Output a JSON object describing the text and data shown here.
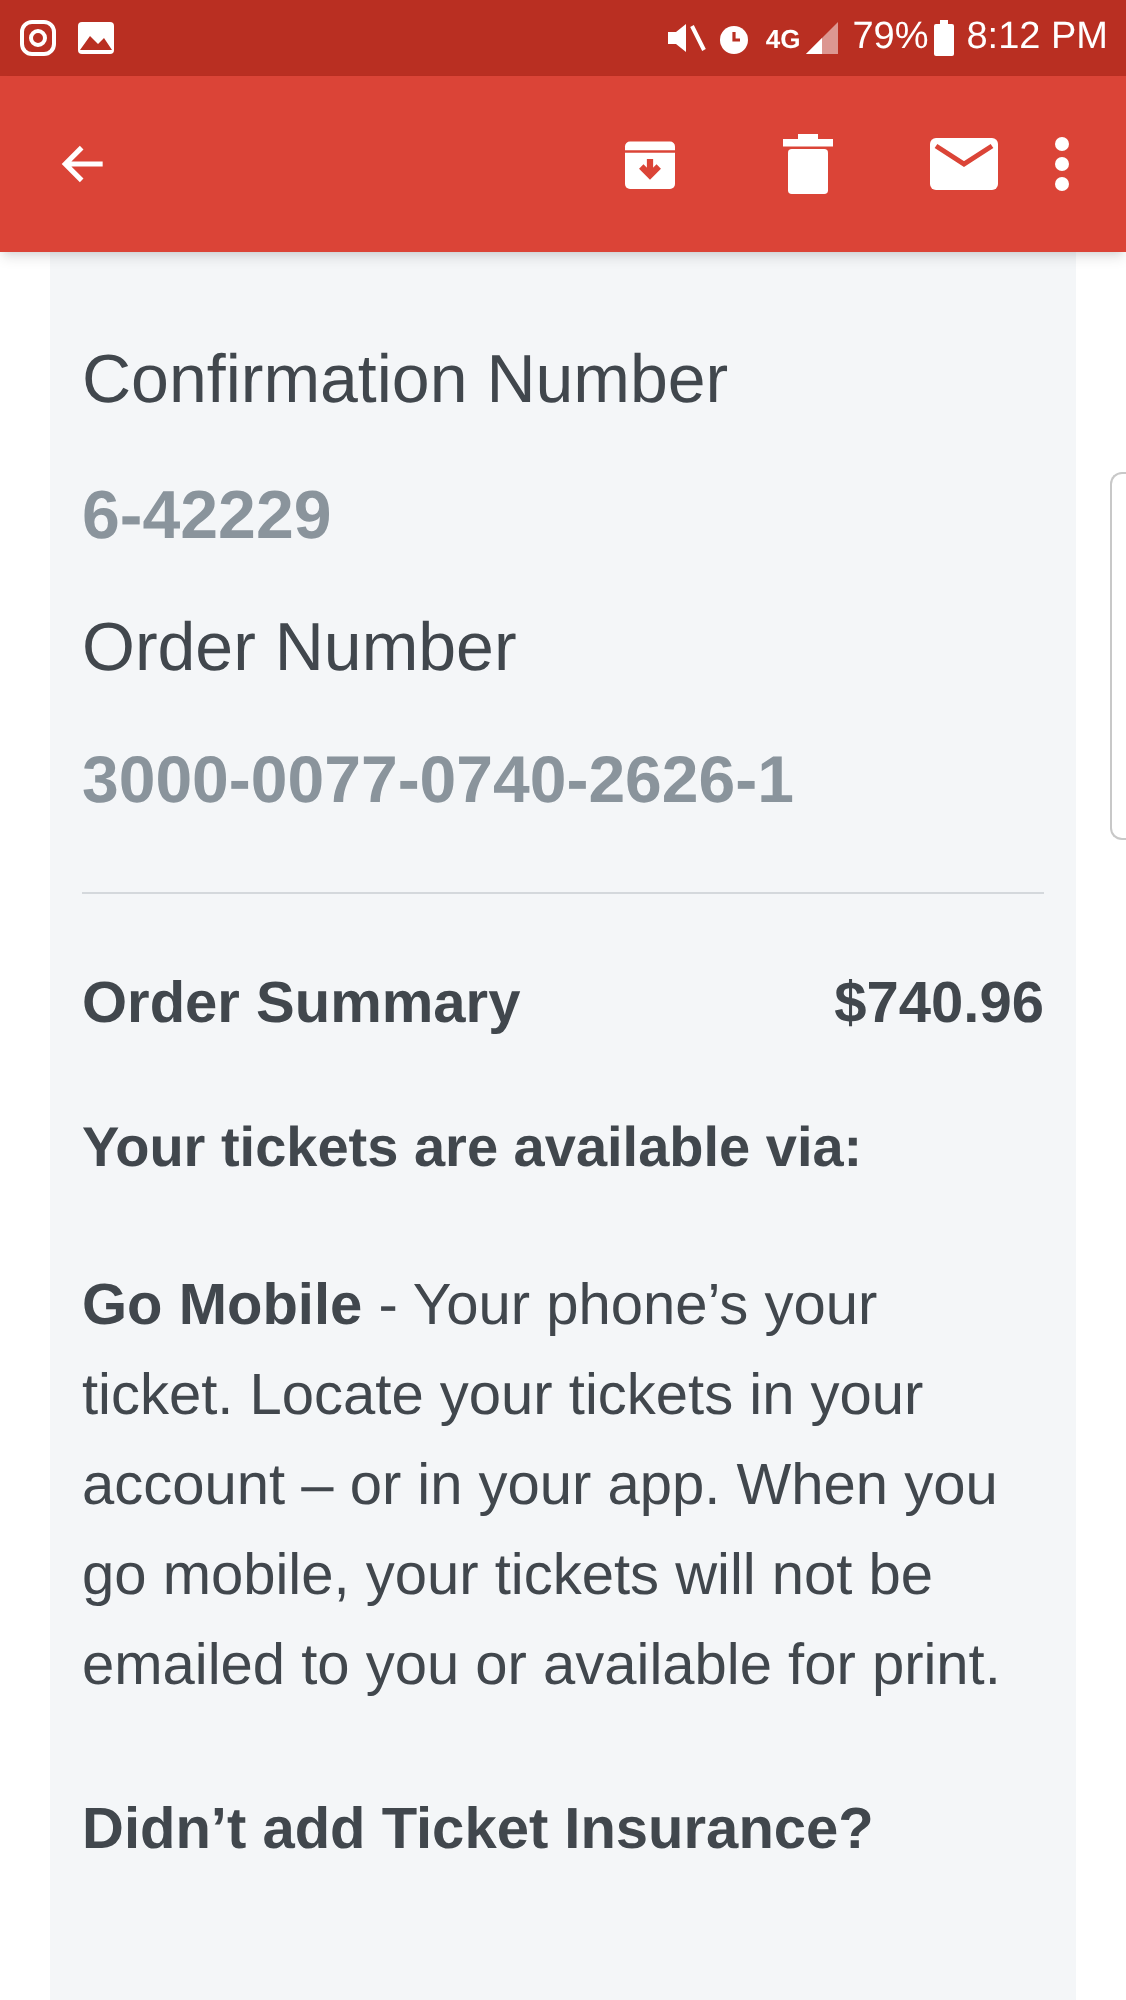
{
  "status_bar": {
    "network": "4G",
    "battery": "79%",
    "time": "8:12 PM"
  },
  "email": {
    "confirmation_label": "Confirmation Number",
    "confirmation_value": "6-42229",
    "order_label": "Order Number",
    "order_value": "3000-0077-0740-2626-1",
    "summary_label": "Order Summary",
    "summary_total": "$740.96",
    "availability_heading": "Your tickets are available via:",
    "go_mobile": "**Go Mobile** - Your phone’s your ticket. Locate your tickets in your account – or in your app. When you go mobile, your tickets will not be emailed to you or available for print.",
    "insurance_heading": "Didn’t add Ticket Insurance?"
  }
}
